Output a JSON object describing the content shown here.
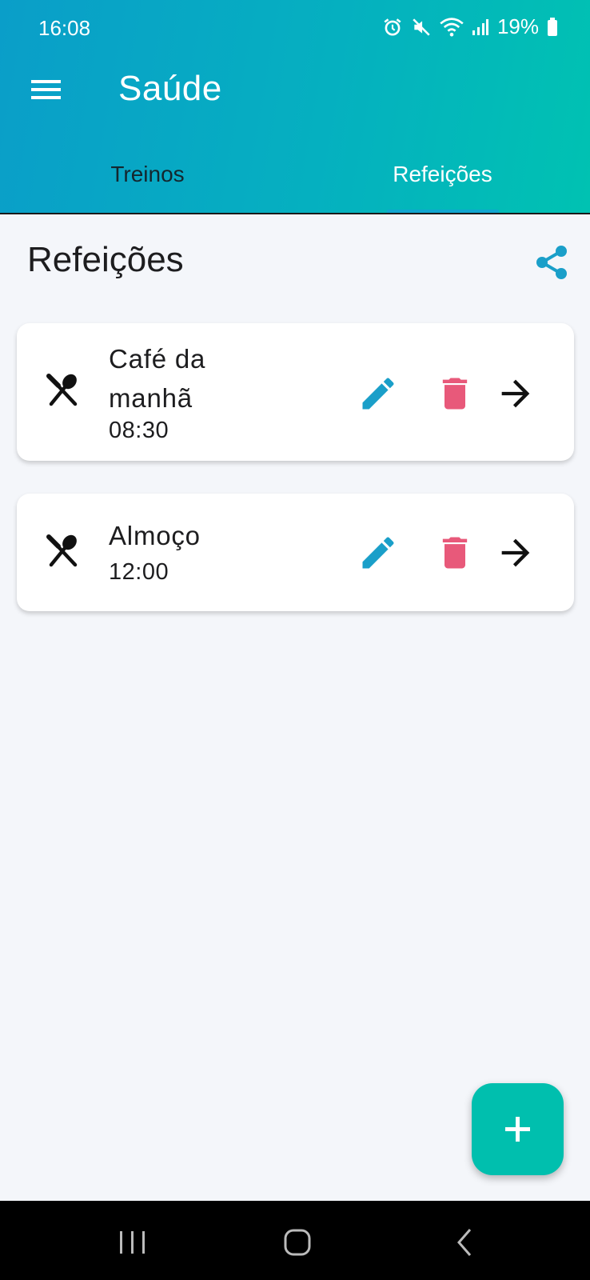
{
  "status_bar": {
    "time": "16:08",
    "battery": "19%",
    "icons": [
      "alarm-icon",
      "mute-icon",
      "wifi-icon",
      "signal-icon",
      "battery-icon"
    ]
  },
  "app_bar": {
    "title": "Saúde",
    "menu_icon": "hamburger-menu-icon",
    "gradient_colors": [
      "#0a9ec9",
      "#00c2b2"
    ]
  },
  "tabs": [
    {
      "label": "Treinos",
      "active": false
    },
    {
      "label": "Refeições",
      "active": true
    }
  ],
  "section": {
    "title": "Refeições",
    "share_icon": "share-icon"
  },
  "meals": [
    {
      "name": "Café da manhã",
      "time": "08:30",
      "icon": "restaurant-icon"
    },
    {
      "name": "Almoço",
      "time": "12:00",
      "icon": "restaurant-icon"
    }
  ],
  "actions": {
    "edit_icon": "pencil-icon",
    "delete_icon": "trash-icon",
    "open_icon": "arrow-right-icon",
    "edit_color": "#1a9fc9",
    "delete_color": "#e8597a"
  },
  "fab": {
    "icon": "plus-icon",
    "color": "#00bfae"
  },
  "nav_bar": {
    "buttons": [
      "recents-icon",
      "home-icon",
      "back-icon"
    ]
  }
}
